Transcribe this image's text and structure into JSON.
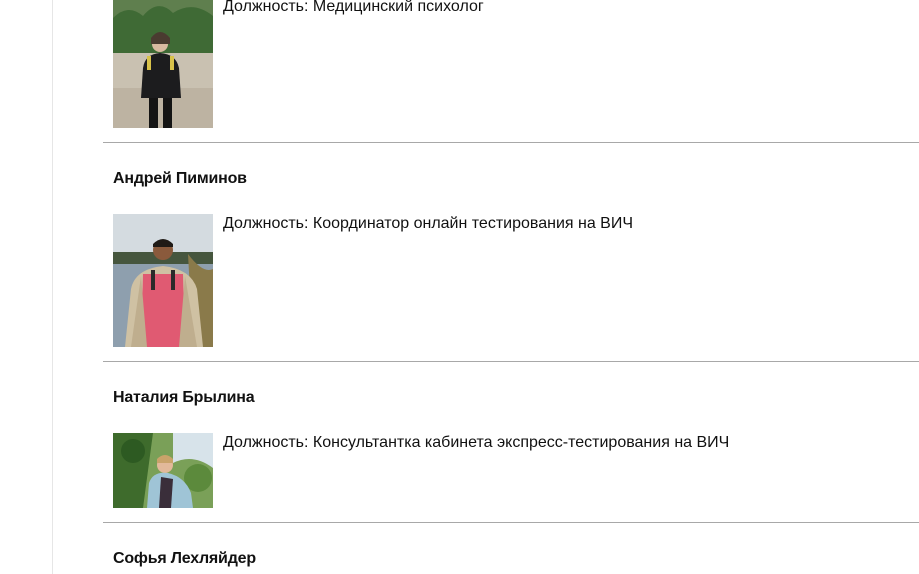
{
  "staff": [
    {
      "name": "",
      "position": "Должность: Медицинский психолог",
      "photo_icon": "person-photo"
    },
    {
      "name": "Андрей Пиминов",
      "position": "Должность: Координатор онлайн тестирования на ВИЧ",
      "photo_icon": "person-photo"
    },
    {
      "name": "Наталия Брылина",
      "position": "Должность: Консультантка кабинета экспресс-тестирования на ВИЧ",
      "photo_icon": "person-photo"
    },
    {
      "name": "Софья Лехляйдер"
    }
  ]
}
